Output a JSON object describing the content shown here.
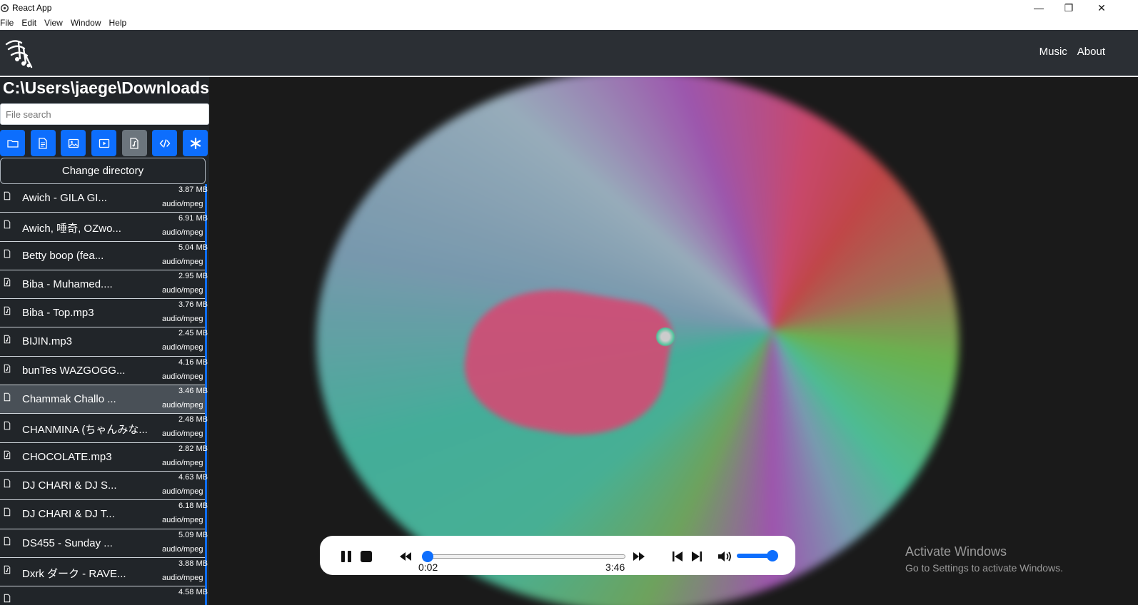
{
  "window": {
    "title": "React App",
    "menu": [
      "File",
      "Edit",
      "View",
      "Window",
      "Help"
    ],
    "minimize": "—",
    "restore": "❐",
    "close": "✕"
  },
  "navbar": {
    "links": [
      "Music",
      "About"
    ]
  },
  "sidebar": {
    "directory": "C:\\Users\\jaege\\Downloads",
    "search_placeholder": "File search",
    "filters": [
      {
        "icon": "folder-icon",
        "active": false
      },
      {
        "icon": "document-icon",
        "active": false
      },
      {
        "icon": "image-icon",
        "active": false
      },
      {
        "icon": "video-icon",
        "active": false
      },
      {
        "icon": "music-file-icon",
        "active": true
      },
      {
        "icon": "code-icon",
        "active": false
      },
      {
        "icon": "asterisk-icon",
        "active": false
      }
    ],
    "change_directory": "Change directory",
    "files": [
      {
        "name": "Awich - GILA GI...",
        "size": "3.87 MB",
        "type": "audio/mpeg",
        "icon": "file-icon",
        "selected": false
      },
      {
        "name": "Awich, 唾奇, OZwo...",
        "size": "6.91 MB",
        "type": "audio/mpeg",
        "icon": "file-icon",
        "selected": false
      },
      {
        "name": "Betty boop (fea...",
        "size": "5.04 MB",
        "type": "audio/mpeg",
        "icon": "file-icon",
        "selected": false
      },
      {
        "name": "Biba - Muhamed....",
        "size": "2.95 MB",
        "type": "audio/mpeg",
        "icon": "music-file-icon",
        "selected": false
      },
      {
        "name": "Biba - Top.mp3",
        "size": "3.76 MB",
        "type": "audio/mpeg",
        "icon": "music-file-icon",
        "selected": false
      },
      {
        "name": "BIJIN.mp3",
        "size": "2.45 MB",
        "type": "audio/mpeg",
        "icon": "music-file-icon",
        "selected": false
      },
      {
        "name": "bunTes WAZGOGG...",
        "size": "4.16 MB",
        "type": "audio/mpeg",
        "icon": "music-file-icon",
        "selected": false
      },
      {
        "name": "Chammak Challo ...",
        "size": "3.46 MB",
        "type": "audio/mpeg",
        "icon": "file-icon",
        "selected": true
      },
      {
        "name": "CHANMINA (ちゃんみな...",
        "size": "2.48 MB",
        "type": "audio/mpeg",
        "icon": "file-icon",
        "selected": false
      },
      {
        "name": "CHOCOLATE.mp3",
        "size": "2.82 MB",
        "type": "audio/mpeg",
        "icon": "music-file-icon",
        "selected": false
      },
      {
        "name": "DJ CHARI & DJ S...",
        "size": "4.63 MB",
        "type": "audio/mpeg",
        "icon": "file-icon",
        "selected": false
      },
      {
        "name": "DJ CHARI & DJ T...",
        "size": "6.18 MB",
        "type": "audio/mpeg",
        "icon": "file-icon",
        "selected": false
      },
      {
        "name": "DS455 - Sunday ...",
        "size": "5.09 MB",
        "type": "audio/mpeg",
        "icon": "file-icon",
        "selected": false
      },
      {
        "name": "Dxrk ダーク - RAVE...",
        "size": "3.88 MB",
        "type": "audio/mpeg",
        "icon": "music-file-icon",
        "selected": false
      },
      {
        "name": "",
        "size": "4.58 MB",
        "type": "",
        "icon": "file-icon",
        "selected": false
      }
    ]
  },
  "player": {
    "current_time": "0:02",
    "duration": "3:46",
    "progress": 0.01,
    "volume": 1.0
  },
  "watermark": {
    "line1": "Activate Windows",
    "line2": "Go to Settings to activate Windows."
  },
  "colors": {
    "accent": "#0d6efd",
    "sidebar_bg": "#212529",
    "navbar_bg": "#2b2f34"
  }
}
